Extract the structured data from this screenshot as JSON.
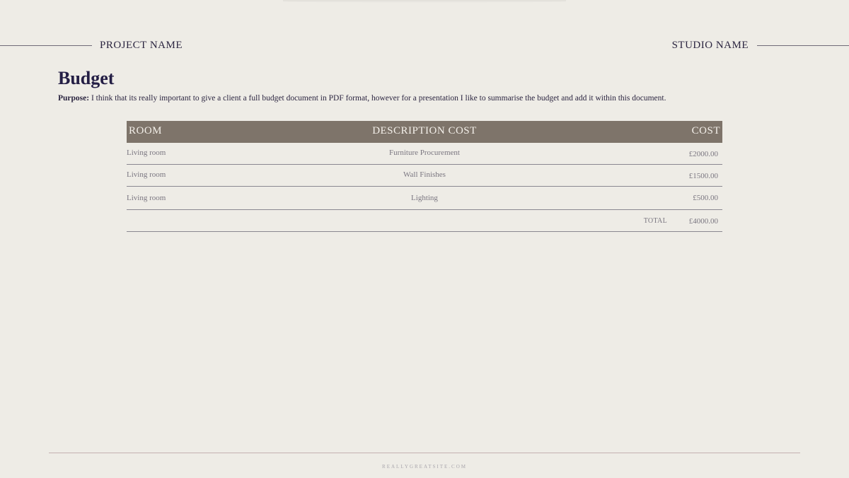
{
  "header": {
    "project_name": "PROJECT NAME",
    "studio_name": "STUDIO NAME"
  },
  "title": "Budget",
  "purpose": {
    "label": "Purpose:",
    "text": " I think that its really important to give a client a full budget document in PDF format, however for a presentation I like to summarise the budget and add it within this document."
  },
  "table": {
    "headers": {
      "room": "ROOM",
      "description": "DESCRIPTION COST",
      "cost": "COST"
    },
    "rows": [
      {
        "room": "Living room",
        "description": "Furniture Procurement",
        "cost": "£2000.00"
      },
      {
        "room": "Living room",
        "description": "Wall Finishes",
        "cost": "£1500.00"
      },
      {
        "room": "Living room",
        "description": "Lighting",
        "cost": "£500.00"
      }
    ],
    "total_label": "TOTAL",
    "total_value": "£4000.00"
  },
  "footer": {
    "website": "REALLYGREATSITE.COM"
  },
  "colors": {
    "background": "#eeece6",
    "header_row": "#7e746a",
    "title": "#241e45"
  }
}
